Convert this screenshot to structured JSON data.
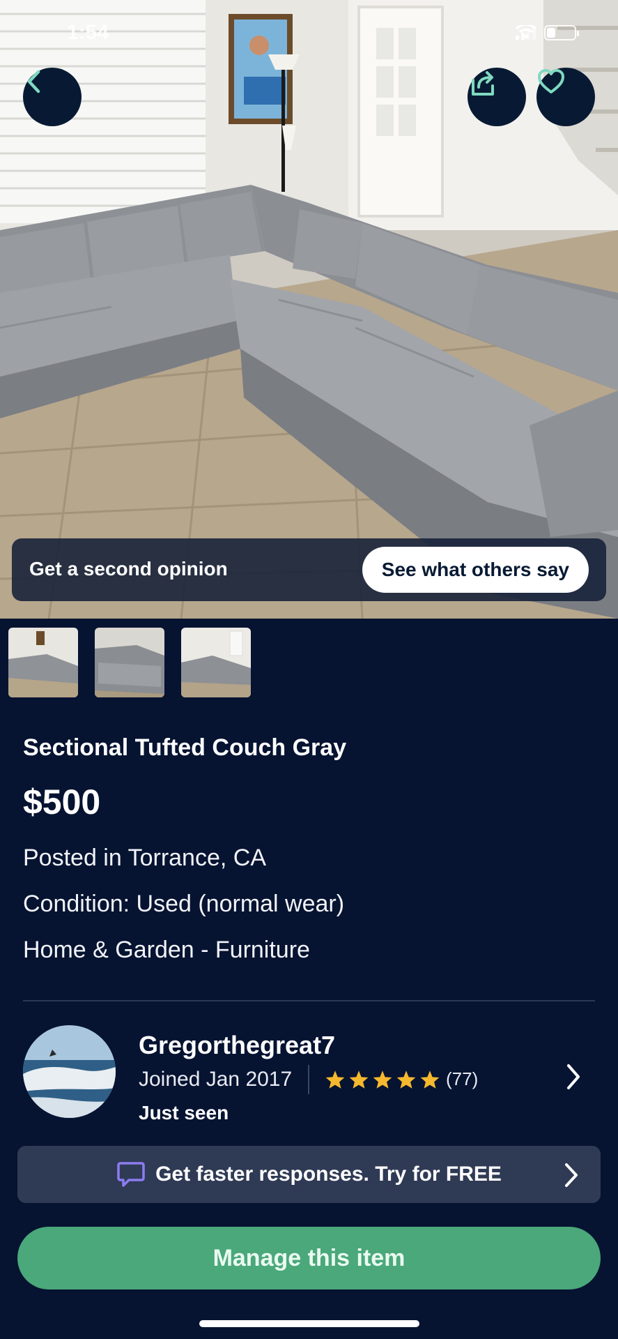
{
  "status_bar": {
    "time": "1:54"
  },
  "hero": {
    "opinion_text": "Get a second opinion",
    "opinion_button": "See what others say"
  },
  "icons": {
    "back": "chevron-left-icon",
    "share": "share-icon",
    "favorite": "heart-icon",
    "chat": "chat-bubble-icon",
    "chevron": "chevron-right-icon",
    "star": "star-icon"
  },
  "thumbnails": [
    {
      "name": "photo-1"
    },
    {
      "name": "photo-2"
    },
    {
      "name": "photo-3"
    }
  ],
  "listing": {
    "title": "Sectional Tufted Couch Gray",
    "price": "$500",
    "location": "Posted in Torrance, CA",
    "condition": "Condition: Used (normal wear)",
    "category": "Home & Garden - Furniture"
  },
  "seller": {
    "name": "Gregorthegreat7",
    "joined": "Joined Jan 2017",
    "rating_stars": 5,
    "rating_count": "(77)",
    "last_seen": "Just seen"
  },
  "promo": {
    "text": "Get faster responses.  Try for FREE"
  },
  "actions": {
    "manage": "Manage this item"
  },
  "colors": {
    "background": "#061331",
    "accent_green": "#4aa87a",
    "star": "#f5b82e",
    "icon_teal": "#7fd9c0",
    "chat_purple": "#8c7cf0"
  }
}
